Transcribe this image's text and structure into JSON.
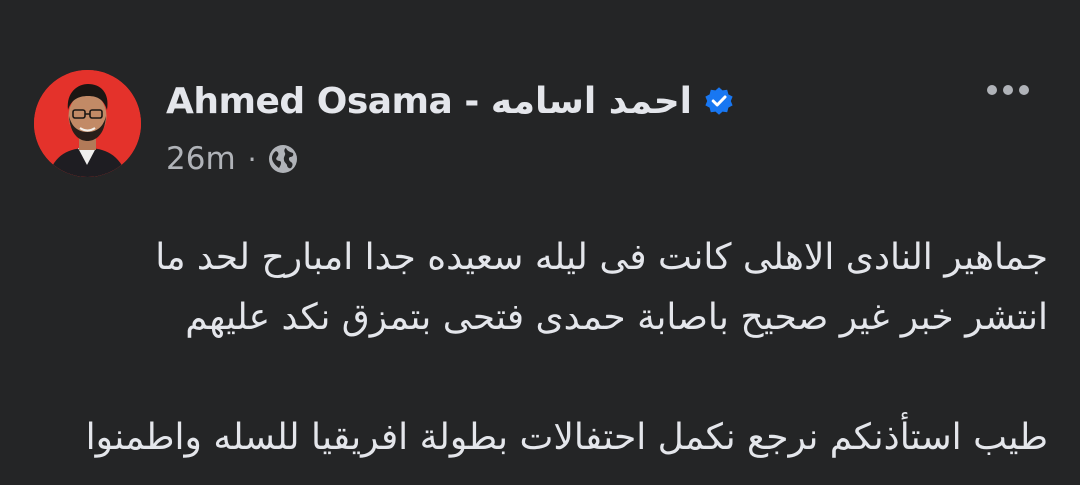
{
  "post": {
    "author": "Ahmed Osama - احمد اسامه",
    "verified_icon": "verified-badge-icon",
    "timestamp": "26m",
    "separator": "·",
    "audience_icon": "globe-icon",
    "more_icon": "more-options-icon",
    "body_lines": [
      "جماهير النادى الاهلى كانت فى ليله سعيده جدا امبارح لحد ما",
      "انتشر خبر غير صحيح باصابة حمدى فتحى بتمزق نكد عليهم",
      "طيب استأذنكم نرجع نكمل احتفالات بطولة افريقيا للسله واطمنوا"
    ]
  },
  "colors": {
    "background": "#242526",
    "primary_text": "#e4e6eb",
    "secondary_text": "#b0b3b8",
    "verified_blue": "#1877f2",
    "avatar_bg": "#e4322b"
  }
}
